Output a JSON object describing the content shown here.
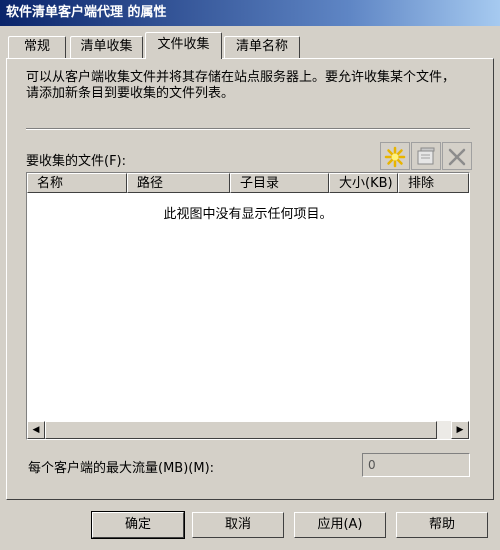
{
  "window": {
    "title": "软件清单客户端代理 的属性"
  },
  "tabs": [
    {
      "label": "常规"
    },
    {
      "label": "清单收集"
    },
    {
      "label": "文件收集",
      "active": true
    },
    {
      "label": "清单名称"
    }
  ],
  "description": "可以从客户端收集文件并将其存储在站点服务器上。要允许收集某个文件，请添加新条目到要收集的文件列表。",
  "file_list": {
    "label": "要收集的文件(F):",
    "columns": [
      "名称",
      "路径",
      "子目录",
      "大小(KB)",
      "排除"
    ],
    "empty_message": "此视图中没有显示任何项目。",
    "toolbar_icons": [
      "new-star-icon",
      "properties-icon",
      "delete-x-icon"
    ]
  },
  "bandwidth": {
    "label": "每个客户端的最大流量(MB)(M):",
    "value": "0"
  },
  "buttons": {
    "ok": "确定",
    "cancel": "取消",
    "apply": "应用(A)",
    "help": "帮助"
  },
  "colors": {
    "titlebar_start": "#0a246a",
    "titlebar_end": "#a6caf0",
    "dialog_face": "#d4d0c8"
  }
}
